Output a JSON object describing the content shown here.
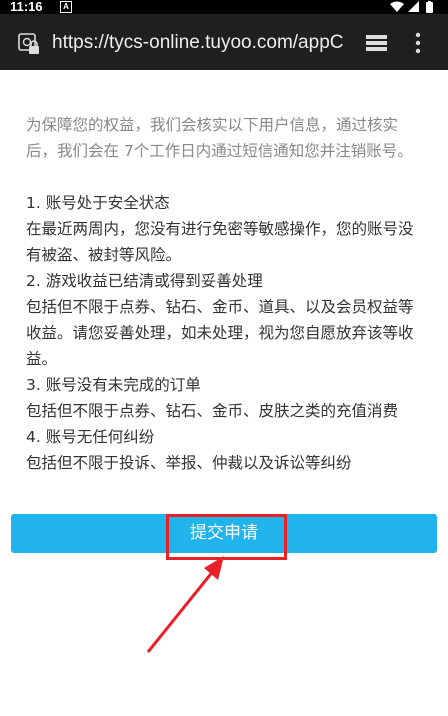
{
  "status_bar": {
    "time": "11:16",
    "notification_letter": "A",
    "icons": [
      "wifi-icon",
      "signal-icon",
      "battery-icon"
    ]
  },
  "browser": {
    "url": "https://tycs-online.tuyoo.com/appCa",
    "icons": [
      "lock-icon",
      "tabs-icon",
      "menu-icon"
    ]
  },
  "content": {
    "intro": "为保障您的权益，我们会核实以下用户信息，通过核实后，我们会在 7个工作日内通过短信通知您并注销账号。",
    "items": [
      {
        "heading": "1. 账号处于安全状态",
        "desc": "在最近两周内，您没有进行免密等敏感操作，您的账号没有被盗、被封等风险。"
      },
      {
        "heading": "2. 游戏收益已结清或得到妥善处理",
        "desc": "包括但不限于点券、钻石、金币、道具、以及会员权益等收益。请您妥善处理，如未处理，视为您自愿放弃该等收益。"
      },
      {
        "heading": "3. 账号没有未完成的订单",
        "desc": "包括但不限于点券、钻石、金币、皮肤之类的充值消费"
      },
      {
        "heading": "4. 账号无任何纠纷",
        "desc": "包括但不限于投诉、举报、仲裁以及诉讼等纠纷"
      }
    ]
  },
  "submit_button": {
    "label": "提交申请",
    "color": "#20b3ec"
  },
  "annotation": {
    "color": "#e8202a"
  }
}
